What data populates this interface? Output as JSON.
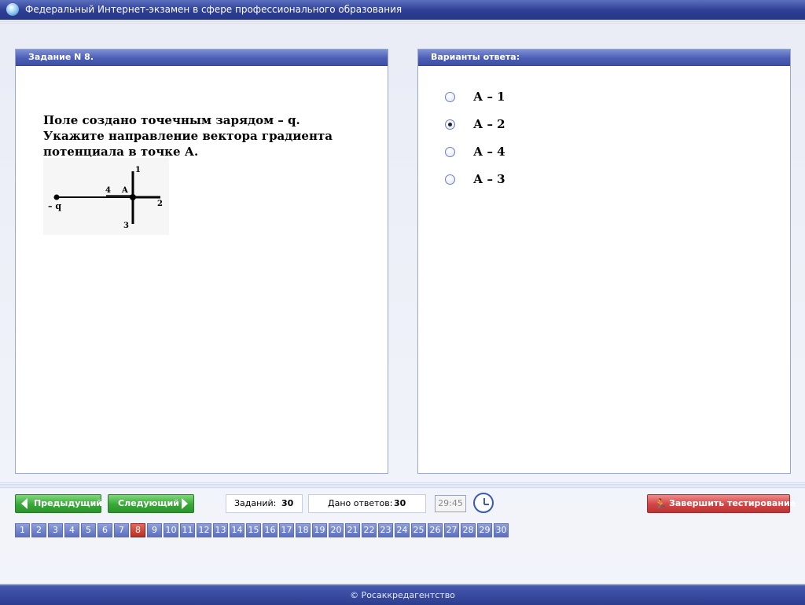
{
  "window": {
    "title": "Федеральный Интернет-экзамен в сфере профессионального образования"
  },
  "task": {
    "header": "Задание N 8.",
    "question": "Поле создано точечным зарядом – q. Укажите направление вектора градиента потенциала в точке А.",
    "figure": {
      "charge_label": "– q",
      "point_label": "A",
      "direction_labels": [
        "1",
        "2",
        "3",
        "4"
      ]
    }
  },
  "answers": {
    "header": "Варианты ответа:",
    "options": [
      {
        "label": "А – 1",
        "selected": false
      },
      {
        "label": "А – 2",
        "selected": true
      },
      {
        "label": "А – 4",
        "selected": false
      },
      {
        "label": "А – 3",
        "selected": false
      }
    ]
  },
  "nav": {
    "prev_label": "Предыдущий",
    "next_label": "Следующий",
    "tasks_label": "Заданий:",
    "tasks_value": "30",
    "answered_label": "Дано ответов:",
    "answered_value": "30",
    "timer": "29:45",
    "finish_label": "Завершить тестирование"
  },
  "pages": {
    "items": [
      "1",
      "2",
      "3",
      "4",
      "5",
      "6",
      "7",
      "8",
      "9",
      "10",
      "11",
      "12",
      "13",
      "14",
      "15",
      "16",
      "17",
      "18",
      "19",
      "20",
      "21",
      "22",
      "23",
      "24",
      "25",
      "26",
      "27",
      "28",
      "29",
      "30"
    ],
    "current": "8"
  },
  "footer": {
    "copyright": "© Росаккредагентство"
  },
  "colors": {
    "header_blue": "#3e50a6",
    "green_button": "#38a838",
    "red_button": "#d04545",
    "active_page": "#b82f22"
  }
}
